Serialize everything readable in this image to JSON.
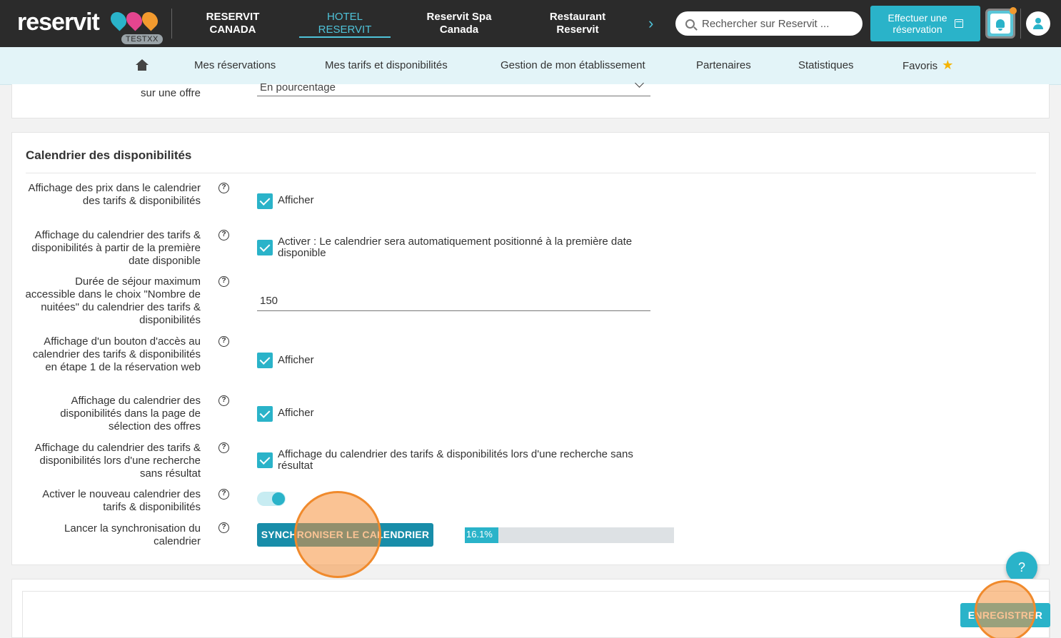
{
  "brand": {
    "logo_text": "reservit",
    "env_badge": "TESTXX"
  },
  "establishments": [
    {
      "label_line1": "RESERVIT",
      "label_line2": "CANADA"
    },
    {
      "label_line1": "HOTEL",
      "label_line2": "RESERVIT",
      "active": true
    },
    {
      "label_line1": "Reservit Spa",
      "label_line2": "Canada"
    },
    {
      "label_line1": "Restaurant",
      "label_line2": "Reservit"
    }
  ],
  "search": {
    "placeholder": "Rechercher sur Reservit ..."
  },
  "booking_button": {
    "line1": "Effectuer une",
    "line2": "réservation"
  },
  "subnav": {
    "items": [
      "Mes réservations",
      "Mes tarifs et disponibilités",
      "Gestion de mon établissement",
      "Partenaires",
      "Statistiques",
      "Favoris"
    ]
  },
  "top_field": {
    "label": "sur une offre",
    "value": "En pourcentage"
  },
  "section": {
    "title": "Calendrier des disponibilités",
    "fields": [
      {
        "label": "Affichage des prix dans le calendrier des tarifs & disponibilités",
        "type": "checkbox",
        "checked": true,
        "text": "Afficher"
      },
      {
        "label": "Affichage du calendrier des tarifs & disponibilités à partir de la première date disponible",
        "type": "checkbox",
        "checked": true,
        "text": "Activer : Le calendrier sera automatiquement positionné à la première date disponible"
      },
      {
        "label": "Durée de séjour maximum accessible dans le choix \"Nombre de nuitées\" du calendrier des tarifs & disponibilités",
        "type": "input",
        "value": "150"
      },
      {
        "label": "Affichage d'un bouton d'accès au calendrier des tarifs & disponibilités en étape 1 de la réservation web",
        "type": "checkbox",
        "checked": true,
        "text": "Afficher"
      },
      {
        "label": "Affichage du calendrier des disponibilités dans la page de sélection des offres",
        "type": "checkbox",
        "checked": true,
        "text": "Afficher"
      },
      {
        "label": "Affichage du calendrier des tarifs & disponibilités lors d'une recherche sans résultat",
        "type": "checkbox",
        "checked": true,
        "text": "Affichage du calendrier des tarifs & disponibilités lors d'une recherche sans résultat"
      },
      {
        "label": "Activer le nouveau calendrier des tarifs & disponibilités",
        "type": "toggle",
        "on": true
      },
      {
        "label": "Lancer la synchronisation du calendrier",
        "type": "action",
        "button": "SYNCHRONISER LE CALENDRIER",
        "progress_text": "16.1%",
        "progress": 0.161
      }
    ]
  },
  "help_fab": "?",
  "save_button": "ENREGISTRER",
  "colors": {
    "accent": "#2ab3c9",
    "topbar": "#2b2b2b",
    "subnav": "#e3f4f8",
    "marker": "#f08a2c"
  },
  "icons": [
    "search-icon",
    "calendar-icon",
    "bell-icon",
    "user-icon",
    "home-icon",
    "star-icon",
    "help-icon",
    "chevron-down-icon",
    "chevron-right-icon"
  ]
}
